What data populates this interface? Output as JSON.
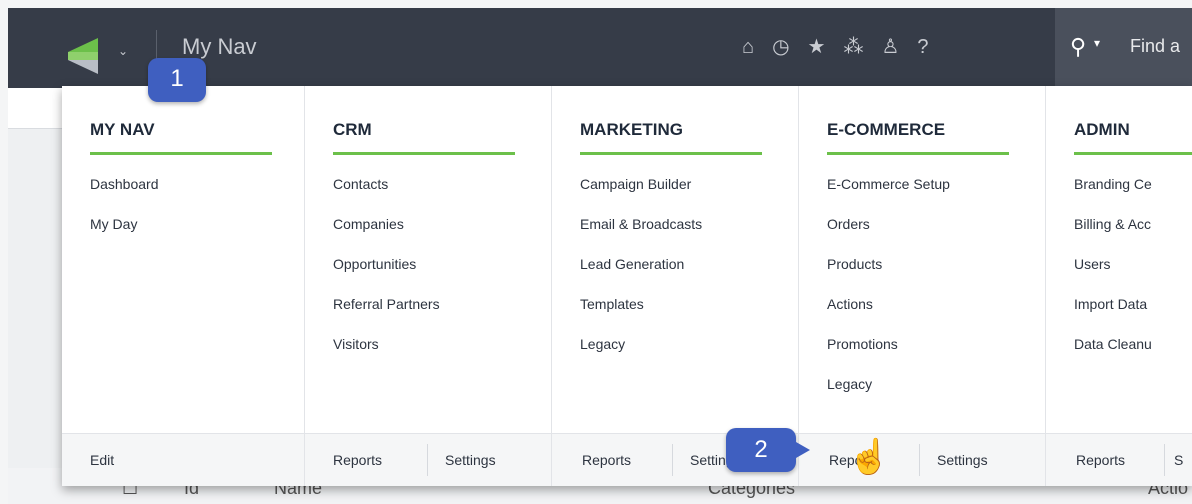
{
  "topbar": {
    "nav_label": "My Nav",
    "icons": [
      "home-icon",
      "clock-icon",
      "star-icon",
      "rockets-icon",
      "user-icon",
      "help-icon"
    ],
    "search": {
      "caret": "▾",
      "placeholder": "Find a"
    }
  },
  "menu": {
    "columns": [
      {
        "title": "MY NAV",
        "items": [
          "Dashboard",
          "My Day"
        ],
        "footer": [
          "Edit"
        ]
      },
      {
        "title": "CRM",
        "items": [
          "Contacts",
          "Companies",
          "Opportunities",
          "Referral Partners",
          "Visitors"
        ],
        "footer": [
          "Reports",
          "Settings"
        ]
      },
      {
        "title": "MARKETING",
        "items": [
          "Campaign Builder",
          "Email & Broadcasts",
          "Lead Generation",
          "Templates",
          "Legacy"
        ],
        "footer": [
          "Reports",
          "Settings"
        ]
      },
      {
        "title": "E-COMMERCE",
        "items": [
          "E-Commerce Setup",
          "Orders",
          "Products",
          "Actions",
          "Promotions",
          "Legacy"
        ],
        "footer": [
          "Reports",
          "Settings"
        ]
      },
      {
        "title": "ADMIN",
        "items": [
          "Branding Ce",
          "Billing & Acc",
          "Users",
          "Import Data",
          "Data Cleanu"
        ],
        "footer": [
          "Reports",
          "S"
        ]
      }
    ]
  },
  "table_header": {
    "col_id": "Id",
    "col_name": "Name",
    "col_categories": "Categories",
    "col_actions": "Actio"
  },
  "badges": {
    "step1": "1",
    "step2": "2"
  },
  "colors": {
    "topbar": "#363c48",
    "accent_green": "#6cc04a",
    "badge_blue": "#3f5fc0"
  }
}
